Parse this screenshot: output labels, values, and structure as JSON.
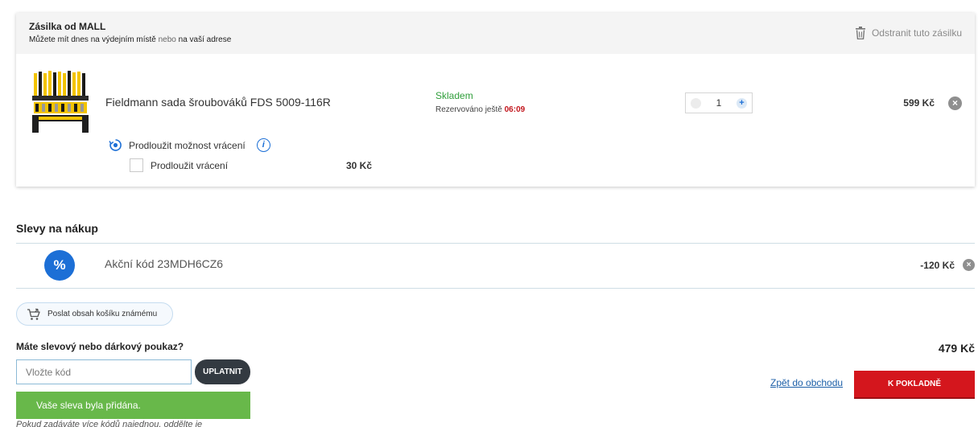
{
  "shipment": {
    "title": "Zásilka od MALL",
    "sub_part1": "Můžete mít dnes na výdejním místě",
    "sub_part2": "nebo",
    "sub_part3": "na vaší adrese",
    "remove_label": "Odstranit tuto zásilku"
  },
  "item": {
    "name": "Fieldmann sada šroubováků FDS 5009-116R",
    "stock": "Skladem",
    "reserve_prefix": "Rezervováno ještě",
    "reserve_time": "06:09",
    "quantity": "1",
    "price": "599 Kč",
    "extend_title": "Prodloužit možnost vrácení",
    "extend_label": "Prodloužit vrácení",
    "extend_price": "30 Kč",
    "extend_checked": false
  },
  "discounts": {
    "title": "Slevy na nákup",
    "badge": "%",
    "code_label": "Akční kód 23MDH6CZ6",
    "amount": "-120 Kč"
  },
  "share_label": "Poslat obsah košíku známému",
  "voucher": {
    "question": "Máte slevový nebo dárkový poukaz?",
    "placeholder": "Vložte kód",
    "apply_label": "UPLATNIT",
    "success_message": "Vaše sleva byla přidána.",
    "hint": "Pokud zadáváte více kódů najednou, oddělte je"
  },
  "summary": {
    "total": "479 Kč",
    "back_label": "Zpět do obchodu",
    "checkout_label": "K POKLADNĚ"
  },
  "colors": {
    "accent_blue": "#1c6fd6",
    "stock_green": "#2f9e3a",
    "success_green": "#68b84a",
    "checkout_red": "#d4161d",
    "timer_red": "#c2161d"
  }
}
